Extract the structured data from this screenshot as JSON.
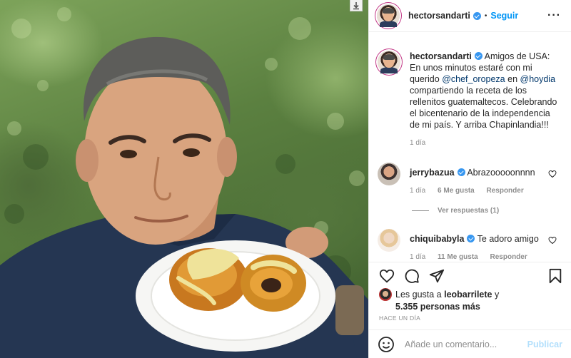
{
  "post": {
    "author": "hectorsandarti",
    "follow_label": "Seguir",
    "dot": "•",
    "more_label": "···"
  },
  "caption": {
    "username": "hectorsandarti",
    "text_start": "Amigos de USA: En unos minutos estaré con mi querido ",
    "mention_1": "@chef_oropeza",
    "text_mid": " en ",
    "mention_2": "@hoydia",
    "text_end": " compartiendo la receta de los rellenitos guatemaltecos. Celebrando el bicentenario de la independencia de mi país. Y arriba Chapinlandia!!!",
    "time": "1 día"
  },
  "comments": [
    {
      "username": "jerrybazua",
      "text": "Abrazooooonnnn",
      "time": "1 día",
      "likes": "6 Me gusta",
      "reply": "Responder"
    },
    {
      "username": "chiquibabyla",
      "text": "Te adoro amigo",
      "time": "1 día",
      "likes": "11 Me gusta",
      "reply": "Responder"
    }
  ],
  "view_replies": "Ver respuestas (1)",
  "likes": {
    "prefix": "Les gusta a ",
    "user": "leobarrilete",
    "suffix": " y",
    "others": "5.355 personas más"
  },
  "age": "HACE UN DÍA",
  "add_comment": {
    "placeholder": "Añade un comentario...",
    "publish_label": "Publicar"
  },
  "colors": {
    "accent": "#0095f6",
    "verified": "#3897f0",
    "muted": "#8e8e8e",
    "publish_disabled": "#b2dffc"
  },
  "icons": [
    "download-icon",
    "verified-badge-icon",
    "more-options-icon",
    "heart-icon",
    "comment-icon",
    "share-icon",
    "bookmark-icon",
    "emoji-icon"
  ]
}
